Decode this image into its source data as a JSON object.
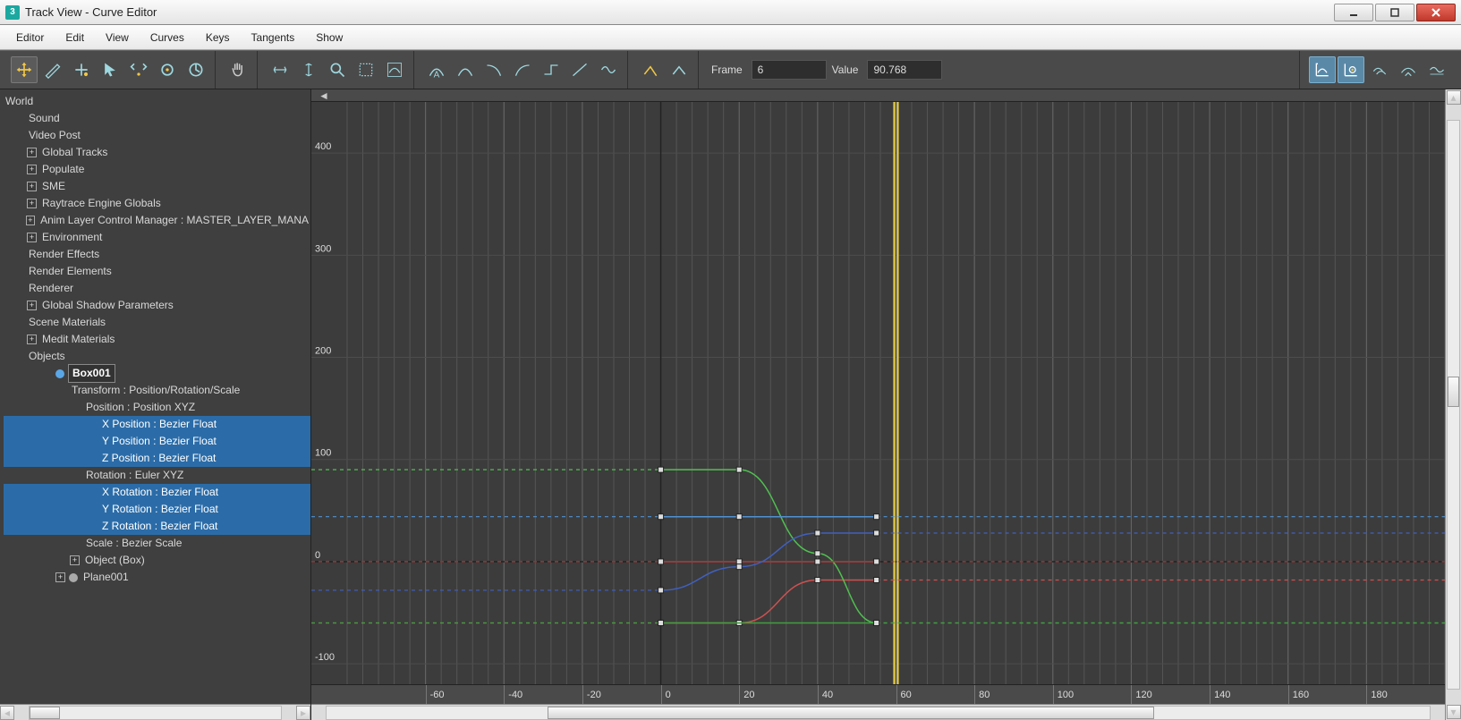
{
  "window": {
    "title": "Track View - Curve Editor",
    "app_glyph": "3"
  },
  "menu": [
    "Editor",
    "Edit",
    "View",
    "Curves",
    "Keys",
    "Tangents",
    "Show"
  ],
  "toolbar": {
    "frame_label": "Frame",
    "frame_value": "6",
    "value_label": "Value",
    "value_value": "90.768"
  },
  "tree": {
    "root": "World",
    "items": [
      {
        "label": "Sound",
        "indent": 1
      },
      {
        "label": "Video Post",
        "indent": 1
      },
      {
        "label": "Global Tracks",
        "indent": 1,
        "exp": "+"
      },
      {
        "label": "Populate",
        "indent": 1,
        "exp": "+"
      },
      {
        "label": "SME",
        "indent": 1,
        "exp": "+"
      },
      {
        "label": "Raytrace Engine Globals",
        "indent": 1,
        "exp": "+"
      },
      {
        "label": "Anim Layer Control Manager : MASTER_LAYER_MANA",
        "indent": 1,
        "exp": "+"
      },
      {
        "label": "Environment",
        "indent": 1,
        "exp": "+"
      },
      {
        "label": "Render Effects",
        "indent": 1
      },
      {
        "label": "Render Elements",
        "indent": 1
      },
      {
        "label": "Renderer",
        "indent": 1
      },
      {
        "label": "Global Shadow Parameters",
        "indent": 1,
        "exp": "+"
      },
      {
        "label": "Scene Materials",
        "indent": 1
      },
      {
        "label": "Medit Materials",
        "indent": 1,
        "exp": "+"
      },
      {
        "label": "Objects",
        "indent": 1
      },
      {
        "label": "Box001",
        "indent": 3,
        "dot": "blue",
        "boxsel": true
      },
      {
        "label": "Transform : Position/Rotation/Scale",
        "indent": 4
      },
      {
        "label": "Position : Position XYZ",
        "indent": 5
      },
      {
        "label": "X Position : Bezier Float",
        "indent": 6,
        "sel": true
      },
      {
        "label": "Y Position : Bezier Float",
        "indent": 6,
        "sel": true
      },
      {
        "label": "Z Position : Bezier Float",
        "indent": 6,
        "sel": true
      },
      {
        "label": "Rotation : Euler XYZ",
        "indent": 5
      },
      {
        "label": "X Rotation : Bezier Float",
        "indent": 6,
        "sel": true
      },
      {
        "label": "Y Rotation : Bezier Float",
        "indent": 6,
        "sel": true
      },
      {
        "label": "Z Rotation : Bezier Float",
        "indent": 6,
        "sel": true
      },
      {
        "label": "Scale : Bezier Scale",
        "indent": 5
      },
      {
        "label": "Object (Box)",
        "indent": 4,
        "exp": "+"
      },
      {
        "label": "Plane001",
        "indent": 3,
        "dot": "gray",
        "exp": "+"
      }
    ]
  },
  "curve": {
    "nav_glyph": "◄",
    "x_range": [
      -80,
      200
    ],
    "y_range": [
      -120,
      450
    ],
    "x_ticks": [
      -60,
      -40,
      -20,
      0,
      20,
      40,
      60,
      80,
      100,
      120,
      140,
      160,
      180
    ],
    "y_ticks": [
      -100,
      0,
      100,
      200,
      300,
      400
    ],
    "time_cursor": 60,
    "curves": [
      {
        "name": "x-position",
        "color": "#d05050",
        "dashedBefore": true,
        "dashedAfter": true,
        "keys": [
          {
            "f": 0,
            "v": -60
          },
          {
            "f": 20,
            "v": -60
          },
          {
            "f": 40,
            "v": -18
          },
          {
            "f": 55,
            "v": -18
          }
        ]
      },
      {
        "name": "y-position",
        "color": "#50c050",
        "dashedBefore": true,
        "dashedAfter": true,
        "keys": [
          {
            "f": 0,
            "v": 90
          },
          {
            "f": 20,
            "v": 90
          },
          {
            "f": 40,
            "v": 8
          },
          {
            "f": 55,
            "v": -60
          }
        ]
      },
      {
        "name": "z-position",
        "color": "#5090d0",
        "dashedBefore": true,
        "dashedAfter": true,
        "keys": [
          {
            "f": 0,
            "v": 44
          },
          {
            "f": 20,
            "v": 44
          },
          {
            "f": 55,
            "v": 44
          }
        ]
      },
      {
        "name": "x-rotation",
        "color": "#b04040",
        "dashedBefore": true,
        "dashedAfter": true,
        "keys": [
          {
            "f": 0,
            "v": 0
          },
          {
            "f": 20,
            "v": 0
          },
          {
            "f": 40,
            "v": 0
          },
          {
            "f": 55,
            "v": 0
          }
        ]
      },
      {
        "name": "y-rotation",
        "color": "#40a040",
        "dashedBefore": true,
        "dashedAfter": true,
        "keys": [
          {
            "f": 0,
            "v": -60
          },
          {
            "f": 55,
            "v": -60
          }
        ]
      },
      {
        "name": "z-rotation",
        "color": "#4060c0",
        "dashedBefore": true,
        "dashedAfter": true,
        "keys": [
          {
            "f": 0,
            "v": -28
          },
          {
            "f": 20,
            "v": -5
          },
          {
            "f": 40,
            "v": 28
          },
          {
            "f": 55,
            "v": 28
          }
        ]
      }
    ]
  }
}
